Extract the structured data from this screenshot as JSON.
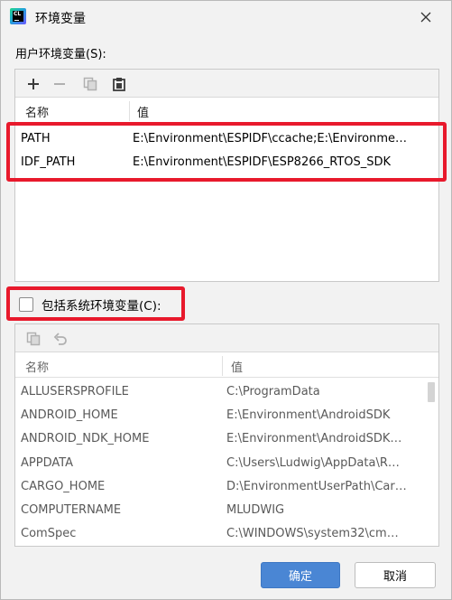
{
  "window": {
    "title": "环境变量",
    "close_icon": "close-icon",
    "app_icon": "clion-icon",
    "app_icon_text": "CL"
  },
  "user_vars": {
    "section_label": "用户环境变量(S):",
    "toolbar": [
      "add-icon",
      "remove-icon",
      "copy-icon",
      "paste-icon"
    ],
    "columns": {
      "name": "名称",
      "value": "值"
    },
    "rows": [
      {
        "name": "PATH",
        "value": "E:\\Environment\\ESPIDF\\ccache;E:\\Environmen…"
      },
      {
        "name": "IDF_PATH",
        "value": "E:\\Environment\\ESPIDF\\ESP8266_RTOS_SDK"
      }
    ]
  },
  "system_vars": {
    "include_label": "包括系统环境变量(C):",
    "include_checked": false,
    "toolbar": [
      "copy-icon",
      "undo-icon"
    ],
    "columns": {
      "name": "名称",
      "value": "值"
    },
    "rows": [
      {
        "name": "ALLUSERSPROFILE",
        "value": "C:\\ProgramData"
      },
      {
        "name": "ANDROID_HOME",
        "value": "E:\\Environment\\AndroidSDK"
      },
      {
        "name": "ANDROID_NDK_HOME",
        "value": "E:\\Environment\\AndroidSDK…"
      },
      {
        "name": "APPDATA",
        "value": "C:\\Users\\Ludwig\\AppData\\R…"
      },
      {
        "name": "CARGO_HOME",
        "value": "D:\\EnvironmentUserPath\\Car…"
      },
      {
        "name": "COMPUTERNAME",
        "value": "MLUDWIG"
      },
      {
        "name": "ComSpec",
        "value": "C:\\WINDOWS\\system32\\cm…"
      }
    ]
  },
  "buttons": {
    "ok": "确定",
    "cancel": "取消"
  },
  "colors": {
    "accent": "#4a86d4",
    "highlight_border": "#e8192c"
  }
}
